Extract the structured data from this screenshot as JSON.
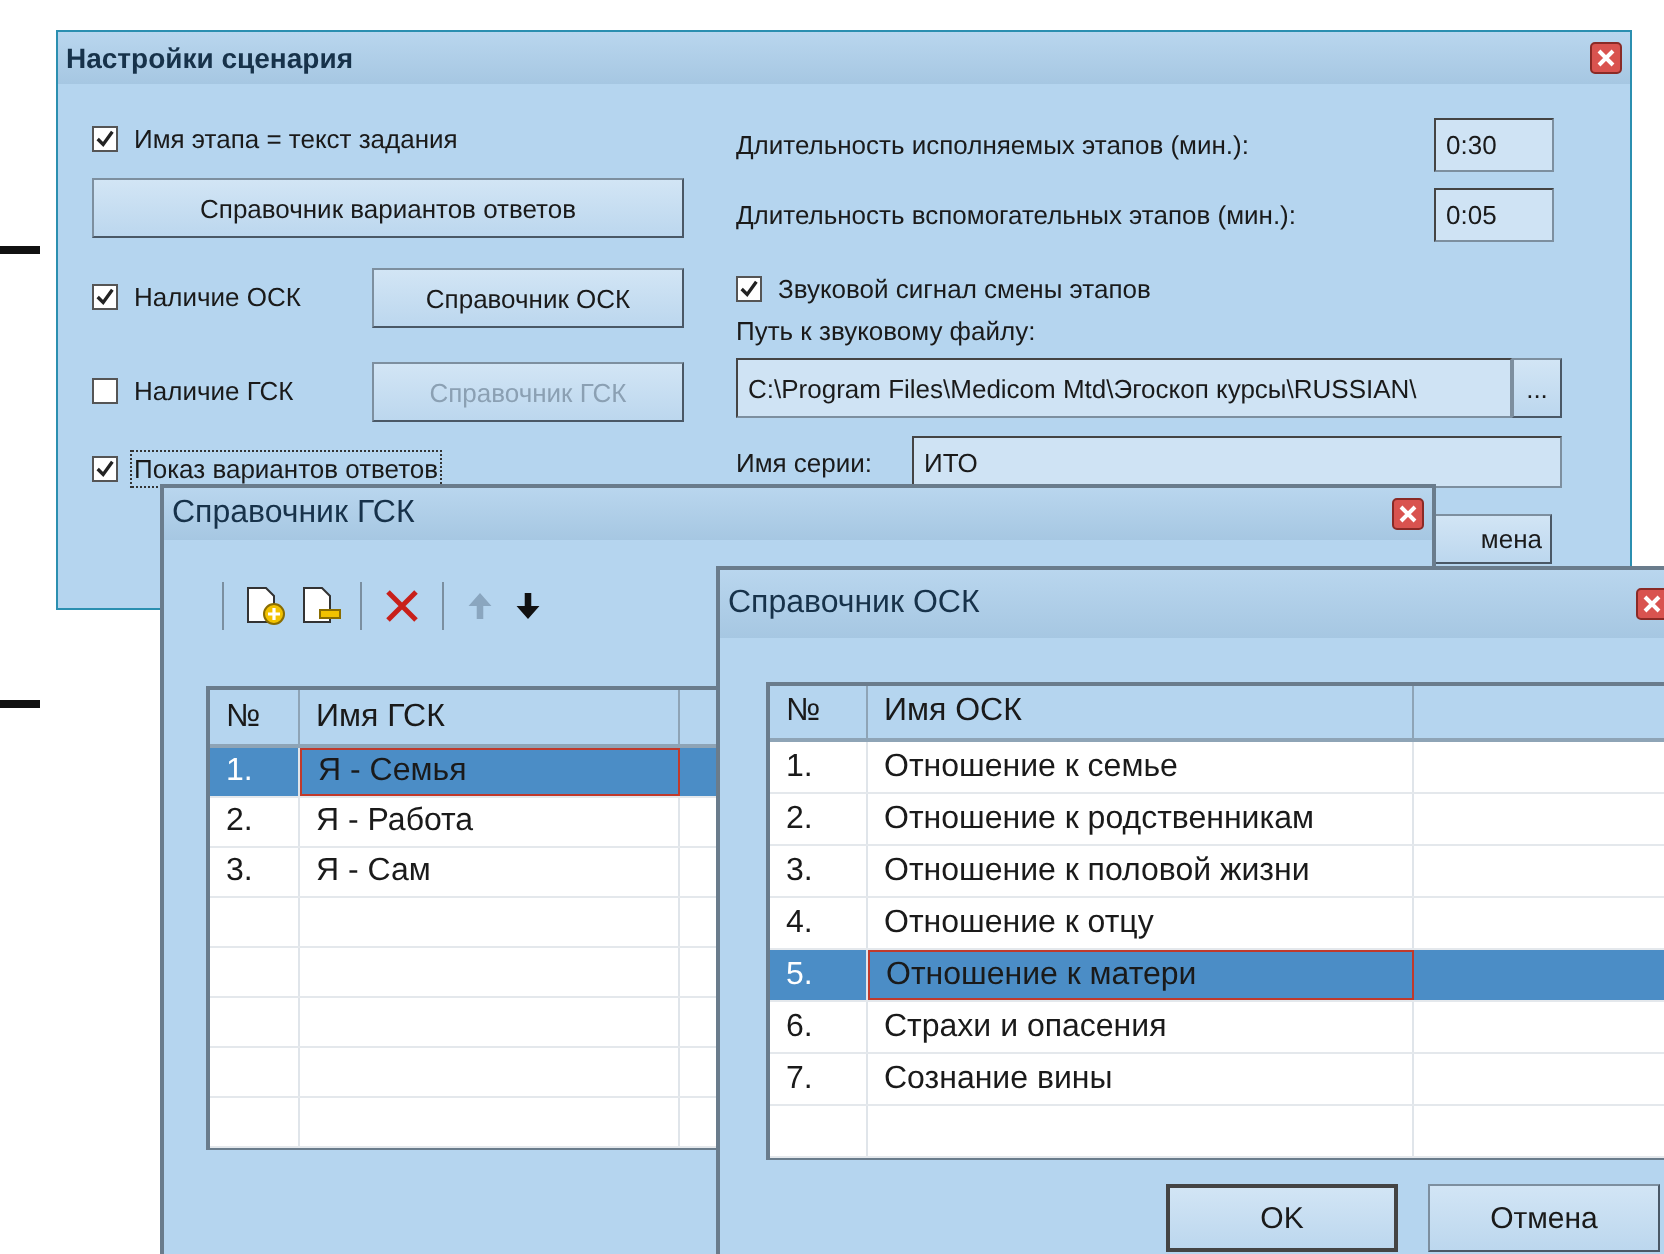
{
  "settings_window": {
    "title": "Настройки сценария",
    "stage_name_checkbox": {
      "label": "Имя этапа = текст задания",
      "checked": true
    },
    "answers_button": {
      "label": "Справочник вариантов ответов"
    },
    "osk_row": {
      "checkbox": {
        "label": "Наличие ОСК",
        "checked": true
      },
      "button": {
        "label": "Справочник ОСК",
        "disabled": false
      }
    },
    "gsk_row": {
      "checkbox": {
        "label": "Наличие ГСК",
        "checked": false
      },
      "button": {
        "label": "Справочник ГСК",
        "disabled": true
      }
    },
    "show_answers_checkbox": {
      "label": "Показ вариантов ответов",
      "checked": true,
      "focused": true
    },
    "durations": [
      {
        "label": "Длительность исполняемых этапов (мин.):",
        "value": "0:30"
      },
      {
        "label": "Длительность вспомогательных этапов (мин.):",
        "value": "0:05"
      }
    ],
    "sound_checkbox": {
      "label": "Звуковой сигнал смены этапов",
      "checked": true
    },
    "sound_path": {
      "label": "Путь к звуковому файлу:",
      "value": "C:\\Program Files\\Medicom Mtd\\Эгоскоп курсы\\RUSSIAN\\",
      "browse_button": "..."
    },
    "series": {
      "label": "Имя серии:",
      "value": "ИТО"
    },
    "partial_button": "мена"
  },
  "gsk_window": {
    "title": "Справочник ГСК",
    "toolbar": [
      {
        "kind": "separator"
      },
      {
        "kind": "add-page",
        "disabled": false
      },
      {
        "kind": "remove-page",
        "disabled": false
      },
      {
        "kind": "separator"
      },
      {
        "kind": "delete",
        "disabled": false
      },
      {
        "kind": "separator"
      },
      {
        "kind": "move-up",
        "disabled": true
      },
      {
        "kind": "move-down",
        "disabled": false
      }
    ],
    "columns": [
      "№",
      "Имя ГСК"
    ],
    "rows": [
      {
        "number": "1.",
        "name": "Я - Семья",
        "selected": true
      },
      {
        "number": "2.",
        "name": "Я - Работа",
        "selected": false
      },
      {
        "number": "3.",
        "name": "Я - Сам",
        "selected": false
      }
    ]
  },
  "osk_window": {
    "title": "Справочник ОСК",
    "columns": [
      "№",
      "Имя ОСК"
    ],
    "rows": [
      {
        "number": "1.",
        "name": "Отношение к семье",
        "selected": false
      },
      {
        "number": "2.",
        "name": "Отношение к родственникам",
        "selected": false
      },
      {
        "number": "3.",
        "name": "Отношение к половой жизни",
        "selected": false
      },
      {
        "number": "4.",
        "name": "Отношение к отцу",
        "selected": false
      },
      {
        "number": "5.",
        "name": "Отношение к матери",
        "selected": true
      },
      {
        "number": "6.",
        "name": "Страхи и опасения",
        "selected": false
      },
      {
        "number": "7.",
        "name": "Сознание вины",
        "selected": false
      }
    ],
    "buttons": [
      "OK",
      "Отмена"
    ]
  }
}
